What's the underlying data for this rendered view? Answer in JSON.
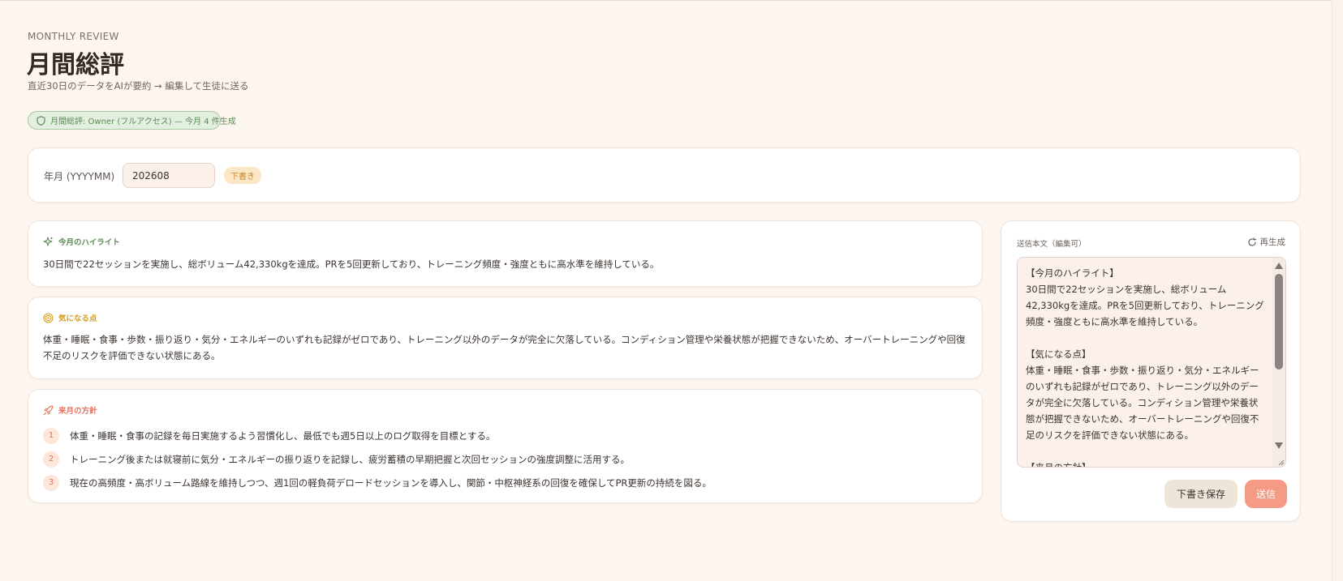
{
  "header": {
    "eyebrow": "MONTHLY REVIEW",
    "title": "月間総評",
    "subtitle": "直近30日のデータをAIが要約 → 編集して生徒に送る"
  },
  "access_badge": {
    "icon": "shield-icon",
    "text": "月間総評: Owner (フルアクセス) — 今月 4 件生成"
  },
  "filter": {
    "label": "年月 (YYYYMM)",
    "value": "202608",
    "status": "下書き"
  },
  "sections": {
    "highlight": {
      "icon": "sparkle-icon",
      "title": "今月のハイライト",
      "body": "30日間で22セッションを実施し、総ボリューム42,330kgを達成。PRを5回更新しており、トレーニング頻度・強度ともに高水準を維持している。"
    },
    "concern": {
      "icon": "target-icon",
      "title": "気になる点",
      "body": "体重・睡眠・食事・歩数・振り返り・気分・エネルギーのいずれも記録がゼロであり、トレーニング以外のデータが完全に欠落している。コンディション管理や栄養状態が把握できないため、オーバートレーニングや回復不足のリスクを評価できない状態にある。"
    },
    "plan": {
      "icon": "rocket-icon",
      "title": "来月の方針",
      "items": [
        {
          "num": "1",
          "text": "体重・睡眠・食事の記録を毎日実施するよう習慣化し、最低でも週5日以上のログ取得を目標とする。"
        },
        {
          "num": "2",
          "text": "トレーニング後または就寝前に気分・エネルギーの振り返りを記録し、疲労蓄積の早期把握と次回セッションの強度調整に活用する。"
        },
        {
          "num": "3",
          "text": "現在の高頻度・高ボリューム路線を維持しつつ、週1回の軽負荷デロードセッションを導入し、関節・中枢神経系の回復を確保してPR更新の持続を図る。"
        }
      ]
    }
  },
  "send_panel": {
    "label": "送信本文（編集可）",
    "regenerate": "再生成",
    "body": "【今月のハイライト】\n30日間で22セッションを実施し、総ボリューム42,330kgを達成。PRを5回更新しており、トレーニング頻度・強度ともに高水準を維持している。\n\n【気になる点】\n体重・睡眠・食事・歩数・振り返り・気分・エネルギーのいずれも記録がゼロであり、トレーニング以外のデータが完全に欠落している。コンディション管理や栄養状態が把握できないため、オーバートレーニングや回復不足のリスクを評価できない状態にある。\n\n【来月の方針】",
    "save_label": "下書き保存",
    "send_label": "送信"
  },
  "colors": {
    "background": "#fdf6f0",
    "accent_green": "#5b8a55",
    "accent_yellow": "#d4a020",
    "accent_coral": "#e7745f",
    "send_button": "#f59a84"
  }
}
